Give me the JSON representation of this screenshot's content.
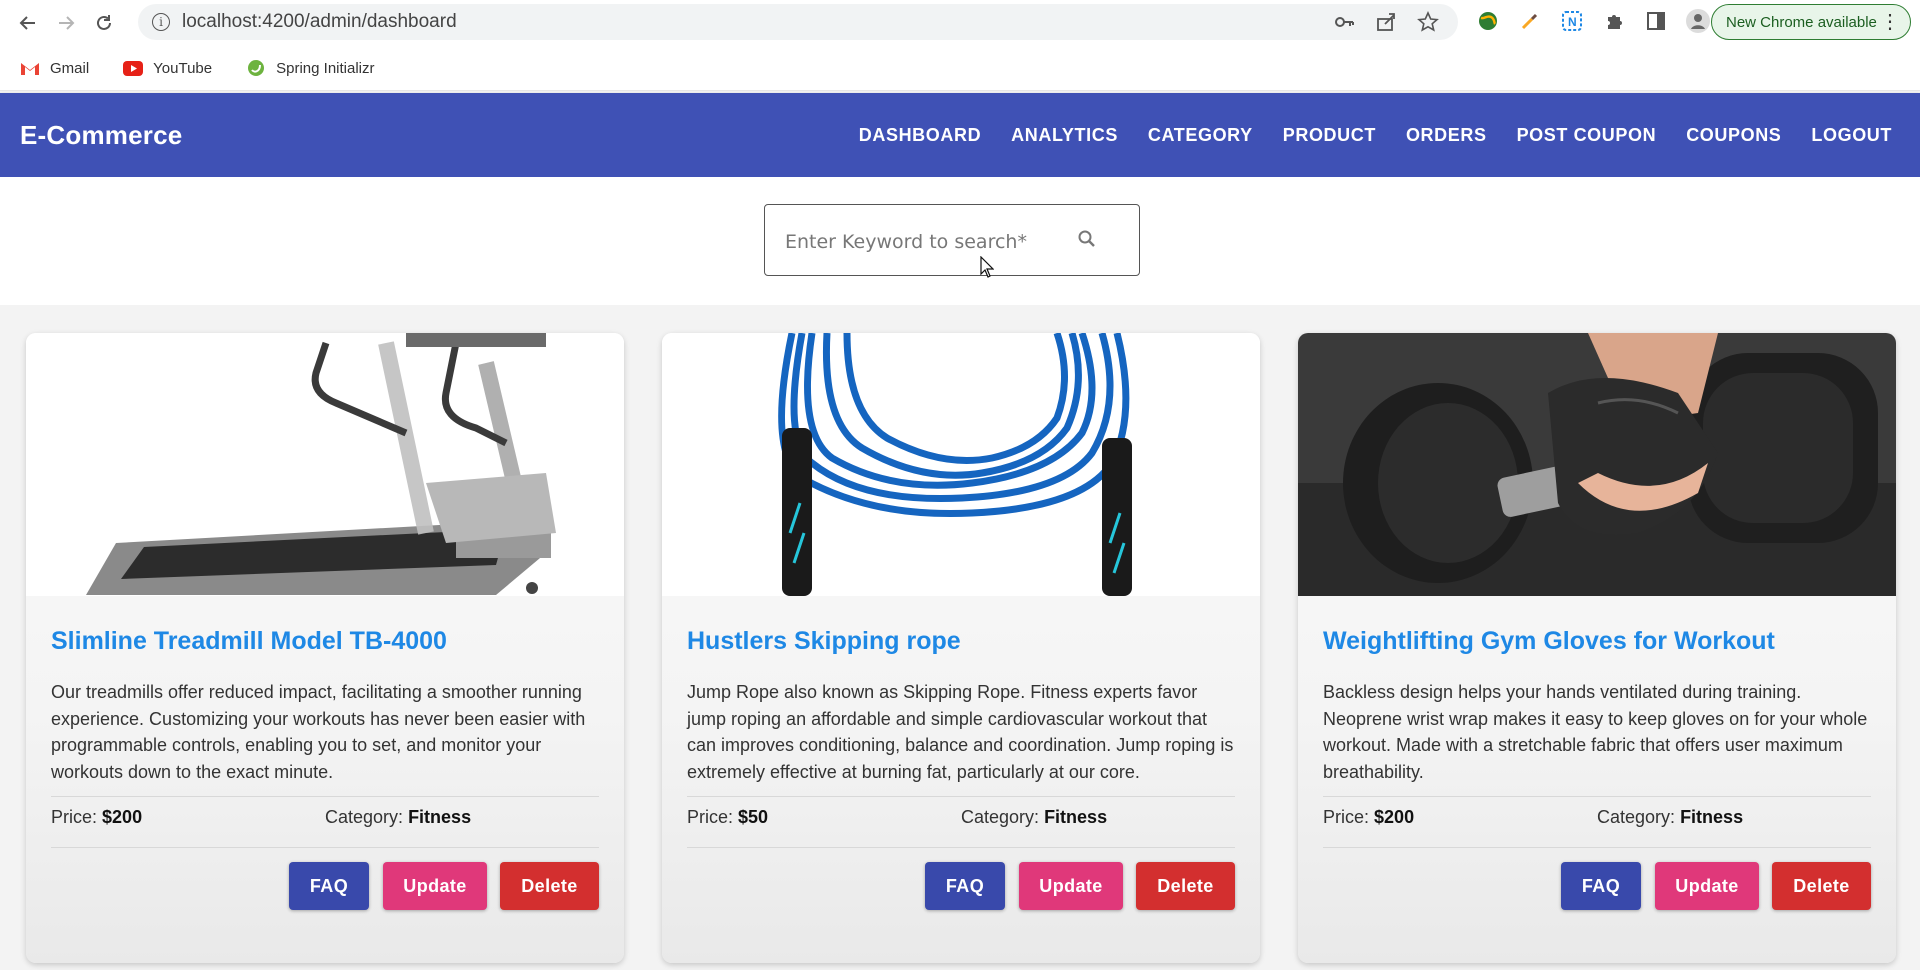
{
  "browser": {
    "url": "localhost:4200/admin/dashboard",
    "update_label": "New Chrome available",
    "bookmarks": [
      {
        "label": "Gmail",
        "icon": "gmail-icon"
      },
      {
        "label": "YouTube",
        "icon": "youtube-icon"
      },
      {
        "label": "Spring Initializr",
        "icon": "spring-icon"
      }
    ]
  },
  "app": {
    "brand": "E-Commerce",
    "header_color": "#3f51b5",
    "nav": [
      "DASHBOARD",
      "ANALYTICS",
      "CATEGORY",
      "PRODUCT",
      "ORDERS",
      "POST COUPON",
      "COUPONS",
      "LOGOUT"
    ]
  },
  "search": {
    "placeholder": "Enter Keyword to search*"
  },
  "labels": {
    "price": "Price:",
    "category": "Category:",
    "faq": "FAQ",
    "update": "Update",
    "delete": "Delete"
  },
  "products": [
    {
      "title": "Slimline Treadmill Model TB-4000",
      "description": "Our treadmills offer reduced impact, facilitating a smoother running experience. Customizing your workouts has never been easier with programmable controls, enabling you to set, and monitor your workouts down to the exact minute.",
      "price": "$200",
      "category": "Fitness",
      "image": "treadmill"
    },
    {
      "title": "Hustlers Skipping rope",
      "description": "Jump Rope also known as Skipping Rope. Fitness experts favor jump roping an affordable and simple cardiovascular workout that can improves conditioning, balance and coordination. Jump roping is extremely effective at burning fat, particularly at our core.",
      "price": "$50",
      "category": "Fitness",
      "image": "skipping-rope"
    },
    {
      "title": "Weightlifting Gym Gloves for Workout",
      "description": "Backless design helps your hands ventilated during training. Neoprene wrist wrap makes it easy to keep gloves on for your whole workout. Made with a stretchable fabric that offers user maximum breathability.",
      "price": "$200",
      "category": "Fitness",
      "image": "gym-gloves-dumbbell"
    }
  ]
}
